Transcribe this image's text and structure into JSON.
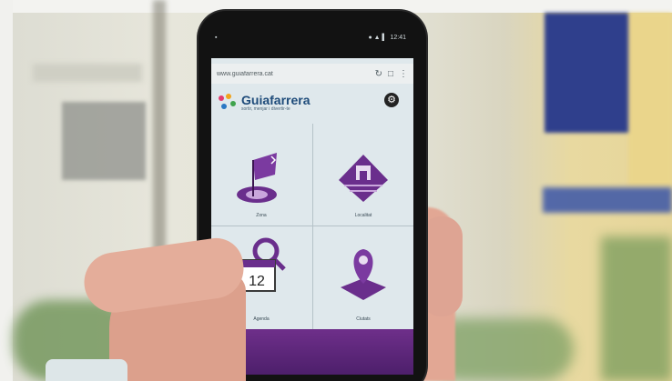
{
  "status": {
    "time": "12:41",
    "icons": "● ▲ ▌"
  },
  "browser": {
    "url": "www.guiafarrera.cat",
    "reload_icon": "reload-icon",
    "tabs_icon": "tabs-icon",
    "menu_icon": "menu-icon"
  },
  "app": {
    "title": "Guiafarrera",
    "subtitle": "sortir, menjar i divertir-te",
    "settings_icon": "gear-icon"
  },
  "tiles": [
    {
      "label": "Zona",
      "icon": "map-flag-icon"
    },
    {
      "label": "Localitat",
      "icon": "town-house-icon"
    },
    {
      "label": "Agenda",
      "icon": "calendar-icon",
      "calendar_day": "12"
    },
    {
      "label": "Ciutats",
      "icon": "map-pin-icon"
    }
  ],
  "colors": {
    "accent": "#6a2e8c",
    "brand_blue": "#1e4b7a",
    "screen_bg": "#dfe8ec"
  }
}
